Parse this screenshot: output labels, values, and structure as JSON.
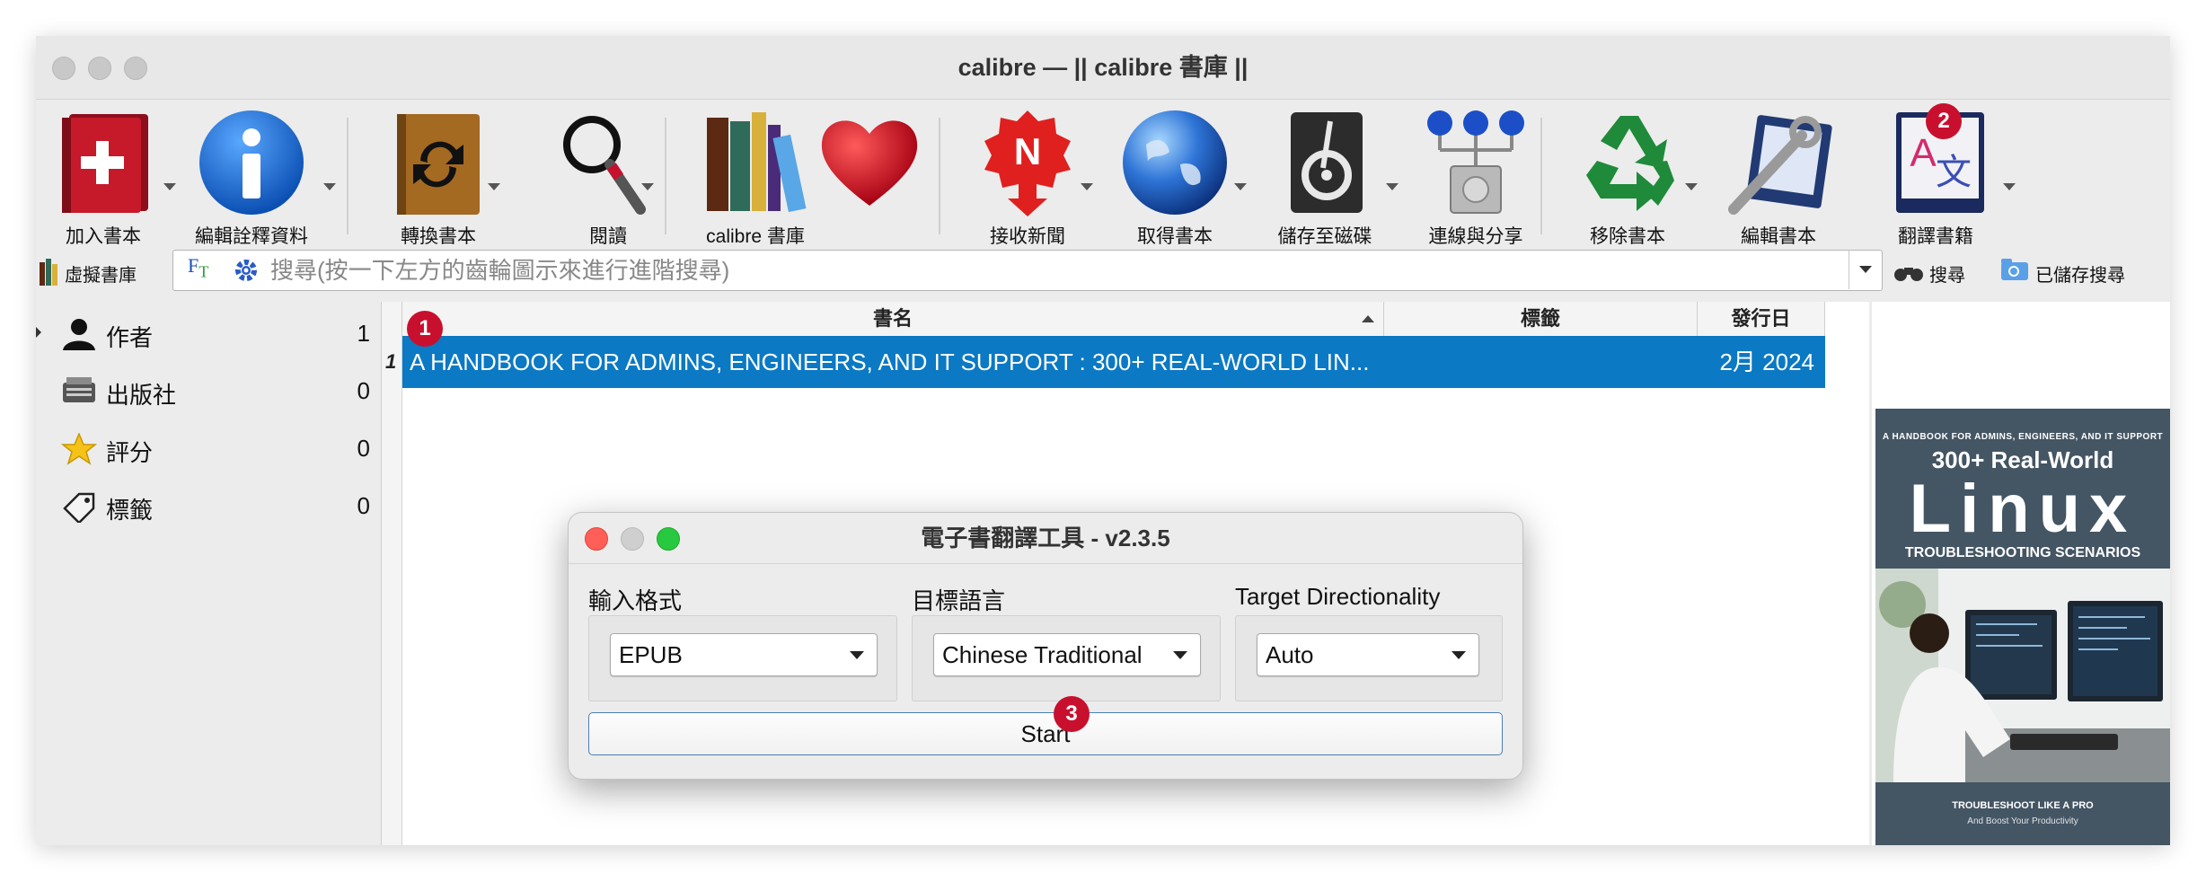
{
  "window": {
    "title": "calibre — || calibre 書庫 ||"
  },
  "toolbar": {
    "items": [
      {
        "label": "加入書本",
        "icon": "add-book-icon"
      },
      {
        "label": "編輯詮釋資料",
        "icon": "info-icon"
      },
      {
        "label": "轉換書本",
        "icon": "convert-book-icon"
      },
      {
        "label": "閱讀",
        "icon": "magnifier-icon"
      },
      {
        "label": "calibre 書庫",
        "icon": "library-books-icon"
      },
      {
        "label": "",
        "icon": "heart-icon"
      },
      {
        "label": "接收新聞",
        "icon": "news-icon"
      },
      {
        "label": "取得書本",
        "icon": "globe-icon"
      },
      {
        "label": "儲存至磁碟",
        "icon": "disk-icon"
      },
      {
        "label": "連線與分享",
        "icon": "connect-share-icon"
      },
      {
        "label": "移除書本",
        "icon": "recycle-icon"
      },
      {
        "label": "編輯書本",
        "icon": "edit-book-icon"
      },
      {
        "label": "翻譯書籍",
        "icon": "translate-icon"
      }
    ]
  },
  "search": {
    "virtual_library": "虛擬書庫",
    "placeholder": "搜尋(按一下左方的齒輪圖示來進行進階搜尋)",
    "search_button": "搜尋",
    "saved_search_button": "已儲存搜尋"
  },
  "tag_browser": {
    "items": [
      {
        "label": "作者",
        "count": "1",
        "icon": "person-icon"
      },
      {
        "label": "出版社",
        "count": "0",
        "icon": "publisher-icon"
      },
      {
        "label": "評分",
        "count": "0",
        "icon": "star-icon"
      },
      {
        "label": "標籤",
        "count": "0",
        "icon": "tag-icon"
      }
    ]
  },
  "book_list": {
    "columns": {
      "title": "書名",
      "tags": "標籤",
      "date": "發行日"
    },
    "rows": [
      {
        "index": "1",
        "title": "A HANDBOOK FOR ADMINS, ENGINEERS, AND IT SUPPORT : 300+ REAL-WORLD LIN...",
        "date": "2月 2024"
      }
    ]
  },
  "cover": {
    "top_line": "A HANDBOOK FOR ADMINS, ENGINEERS, AND IT SUPPORT",
    "line2": "300+ Real-World",
    "line3": "Linux",
    "line4": "TROUBLESHOOTING SCENARIOS",
    "footer1": "TROUBLESHOOT LIKE A PRO",
    "footer2": "And Boost Your Productivity"
  },
  "dialog": {
    "title": "電子書翻譯工具 - v2.3.5",
    "input_format_label": "輸入格式",
    "input_format_value": "EPUB",
    "target_language_label": "目標語言",
    "target_language_value": "Chinese Traditional",
    "target_direction_label": "Target Directionality",
    "target_direction_value": "Auto",
    "start_label": "Start"
  },
  "badges": {
    "b1": "1",
    "b2": "2",
    "b3": "3"
  },
  "colors": {
    "selection": "#0b79c4",
    "badge": "#c8102e",
    "cover_bg": "#445563"
  }
}
